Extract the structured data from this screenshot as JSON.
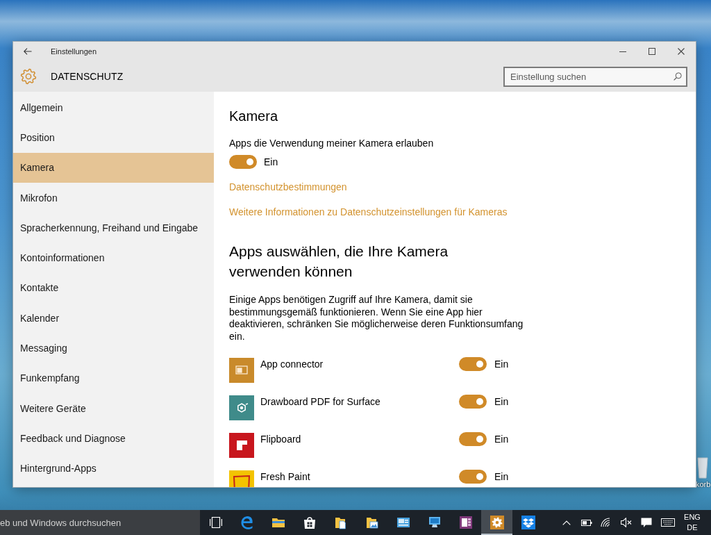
{
  "window": {
    "title": "Einstellungen",
    "section": "DATENSCHUTZ",
    "search": {
      "placeholder": "Einstellung suchen"
    }
  },
  "sidebar": {
    "items": [
      {
        "label": "Allgemein",
        "selected": false
      },
      {
        "label": "Position",
        "selected": false
      },
      {
        "label": "Kamera",
        "selected": true
      },
      {
        "label": "Mikrofon",
        "selected": false
      },
      {
        "label": "Spracherkennung, Freihand und Eingabe",
        "selected": false
      },
      {
        "label": "Kontoinformationen",
        "selected": false
      },
      {
        "label": "Kontakte",
        "selected": false
      },
      {
        "label": "Kalender",
        "selected": false
      },
      {
        "label": "Messaging",
        "selected": false
      },
      {
        "label": "Funkempfang",
        "selected": false
      },
      {
        "label": "Weitere Geräte",
        "selected": false
      },
      {
        "label": "Feedback und Diagnose",
        "selected": false
      },
      {
        "label": "Hintergrund-Apps",
        "selected": false
      }
    ]
  },
  "content": {
    "title": "Kamera",
    "master_toggle": {
      "label": "Apps die Verwendung meiner Kamera erlauben",
      "on": true,
      "state_text": "Ein"
    },
    "links": [
      "Datenschutzbestimmungen",
      "Weitere Informationen zu Datenschutzeinstellungen für Kameras"
    ],
    "apps_heading": "Apps auswählen, die Ihre Kamera verwenden können",
    "description": "Einige Apps benötigen Zugriff auf Ihre Kamera, damit sie bestimmungsgemäß funktionieren. Wenn Sie eine App hier deaktivieren, schränken Sie möglicherweise deren Funktionsumfang ein.",
    "apps": [
      {
        "name": "App connector",
        "color": "#c98a2b",
        "on": true,
        "state_text": "Ein"
      },
      {
        "name": "Drawboard PDF for Surface",
        "color": "#3f8b8a",
        "on": true,
        "state_text": "Ein"
      },
      {
        "name": "Flipboard",
        "color": "#c8161d",
        "on": true,
        "state_text": "Ein"
      },
      {
        "name": "Fresh Paint",
        "color": "#f3c300",
        "on": true,
        "state_text": "Ein"
      }
    ]
  },
  "taskbar": {
    "search": {
      "placeholder": "eb und Windows durchsuchen"
    },
    "apps": [
      {
        "selected": false
      },
      {
        "selected": false
      },
      {
        "selected": false
      },
      {
        "selected": false
      },
      {
        "selected": false
      },
      {
        "selected": false
      },
      {
        "selected": false
      },
      {
        "selected": false
      },
      {
        "selected": true
      },
      {
        "selected": false
      }
    ],
    "language": [
      "ENG",
      "DE"
    ]
  },
  "desktop": {
    "icons": [
      {
        "label": "korb"
      }
    ]
  }
}
